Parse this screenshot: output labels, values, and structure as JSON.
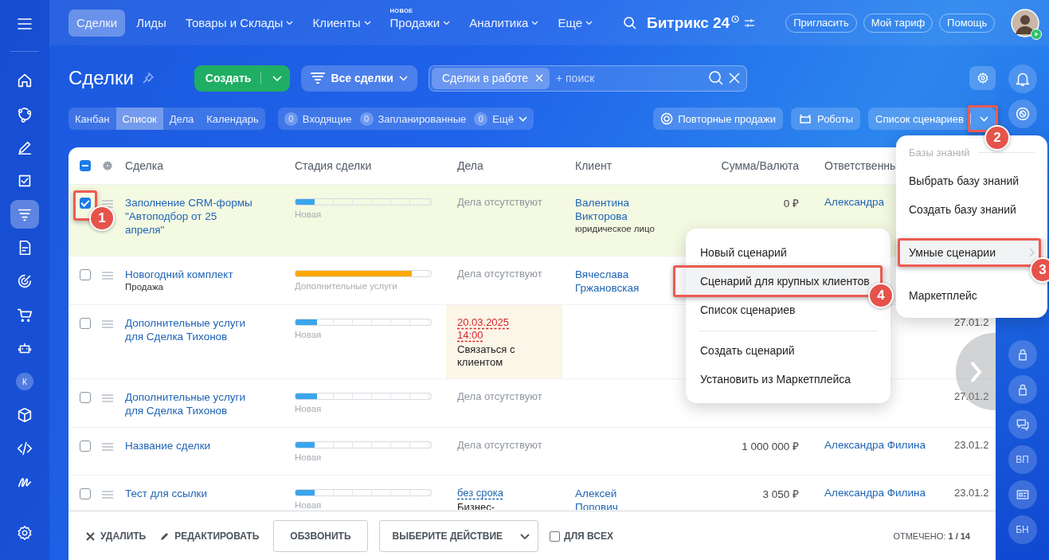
{
  "sidebar": {
    "items": [
      {
        "kind": "icon",
        "selected": false
      },
      {
        "kind": "icon",
        "selected": false
      },
      {
        "kind": "icon",
        "selected": false
      },
      {
        "kind": "icon",
        "selected": false
      },
      {
        "kind": "icon",
        "selected": true
      },
      {
        "kind": "icon",
        "selected": false
      },
      {
        "kind": "icon",
        "selected": false
      },
      {
        "kind": "icon",
        "selected": false
      },
      {
        "kind": "icon",
        "selected": false
      },
      {
        "kind": "avatar",
        "label": "К",
        "selected": false
      },
      {
        "kind": "icon",
        "selected": false
      },
      {
        "kind": "icon",
        "selected": false
      },
      {
        "kind": "icon",
        "selected": false
      }
    ]
  },
  "nav": {
    "tabs": [
      {
        "label": "Сделки",
        "selected": true,
        "dropdown": false
      },
      {
        "label": "Лиды",
        "selected": false,
        "dropdown": false
      },
      {
        "label": "Товары и Склады",
        "selected": false,
        "dropdown": true
      },
      {
        "label": "Клиенты",
        "selected": false,
        "dropdown": true
      },
      {
        "label": "Продажи",
        "selected": false,
        "dropdown": true,
        "badge": "НОВОЕ"
      },
      {
        "label": "Аналитика",
        "selected": false,
        "dropdown": true
      },
      {
        "label": "Еще",
        "selected": false,
        "dropdown": true
      }
    ],
    "logo": "Битрикс",
    "logo_number": "24",
    "buttons": [
      "Пригласить",
      "Мой тариф",
      "Помощь"
    ]
  },
  "page": {
    "title": "Сделки",
    "create_button": "Создать",
    "filter_button": "Все сделки",
    "search": {
      "chip": "Сделки в работе",
      "placeholder": "+ поиск"
    }
  },
  "views": [
    {
      "label": "Канбан",
      "selected": false
    },
    {
      "label": "Список",
      "selected": true
    },
    {
      "label": "Дела",
      "selected": false
    },
    {
      "label": "Календарь",
      "selected": false
    }
  ],
  "counters": [
    {
      "count": "0",
      "label": "Входящие",
      "dropdown": false
    },
    {
      "count": "0",
      "label": "Запланированные",
      "dropdown": false
    },
    {
      "count": "0",
      "label": "Ещё",
      "dropdown": true
    }
  ],
  "tools": {
    "repeat_sales": "Повторные продажи",
    "robots": "Роботы",
    "scenarios": {
      "label": "Список сценариев",
      "callout": "2"
    }
  },
  "table": {
    "header_checkbox": {
      "indeterminate": true
    },
    "columns": [
      "Сделка",
      "Стадия сделки",
      "Дела",
      "Клиент",
      "Сумма/Валюта",
      "Ответственны"
    ],
    "rows": [
      {
        "checked": true,
        "callout": "1",
        "title": "Заполнение CRM-формы \"Автоподбор от 25 апреля\"",
        "stage": {
          "label": "Новая",
          "level": 0.14,
          "color": "#3aa5ec"
        },
        "activity": {
          "kind": "none",
          "text": "Дела отсутствуют"
        },
        "client": {
          "name": "Валентина Викторова",
          "type": "юридическое лицо"
        },
        "sum": "0 ₽",
        "responsible": "Александра"
      },
      {
        "checked": false,
        "title": "Новогодний комплект",
        "subtitle": "Продажа",
        "stage": {
          "label": "Дополнительные услуги",
          "level": 0.86,
          "color": "#ffa800"
        },
        "activity": {
          "kind": "none",
          "text": "Дела отсутствуют"
        },
        "client": {
          "name": "Вячеслава Гржановская"
        }
      },
      {
        "checked": false,
        "title": "Дополнительные услуги для Сделка Тихонов",
        "stage": {
          "label": "Новая",
          "level": 0.16,
          "color": "#3aa5ec"
        },
        "activity": {
          "kind": "deadline",
          "date": "20.03.2025 14:00",
          "text": "Связаться с клиентом"
        },
        "date": "27.01.2"
      },
      {
        "checked": false,
        "title": "Дополнительные услуги для Сделка Тихонов",
        "stage": {
          "label": "Новая",
          "level": 0.16,
          "color": "#3aa5ec"
        },
        "activity": {
          "kind": "none",
          "text": "Дела отсутствуют"
        },
        "date": "27.01.2"
      },
      {
        "checked": false,
        "title": "Название сделки",
        "stage": {
          "label": "Новая",
          "level": 0.14,
          "color": "#3aa5ec"
        },
        "activity": {
          "kind": "none",
          "text": "Дела отсутствуют"
        },
        "sum": "1 000 000 ₽",
        "responsible": "Александра Филина",
        "date": "23.01.2"
      },
      {
        "checked": false,
        "title": "Тест для ссылки",
        "stage": {
          "label": "Новая",
          "level": 0.14,
          "color": "#3aa5ec"
        },
        "activity": {
          "kind": "no_deadline",
          "date": "без срока",
          "text": "Бизнес-"
        },
        "client": {
          "name": "Алексей Попович"
        },
        "sum": "3 050 ₽",
        "responsible": "Александра Филина",
        "date": "23.01.2"
      }
    ]
  },
  "menu": {
    "heading": "Базы знаний",
    "items": [
      {
        "label": "Выбрать базу знаний",
        "selected": false,
        "submenu": false
      },
      {
        "label": "Создать базу знаний",
        "selected": false,
        "submenu": false
      },
      {
        "label": "Умные сценарии",
        "selected": true,
        "submenu": true,
        "callout": "3"
      },
      {
        "label": "Маркетплейс",
        "selected": false,
        "submenu": false
      }
    ]
  },
  "submenu": {
    "items": [
      {
        "label": "Новый сценарий",
        "selected": false,
        "divider_before": false
      },
      {
        "label": "Сценарий для крупных клиентов",
        "selected": true,
        "divider_before": false,
        "callout": "4"
      },
      {
        "label": "Список сценариев",
        "selected": false,
        "divider_before": false
      },
      {
        "label": "Создать сценарий",
        "selected": false,
        "divider_before": true
      },
      {
        "label": "Установить из Маркетплейса",
        "selected": false,
        "divider_before": false
      }
    ]
  },
  "right_rail": {
    "top": [
      {
        "kind": "icon"
      },
      {
        "kind": "icon"
      }
    ],
    "bottom": [
      {
        "kind": "icon"
      },
      {
        "kind": "icon"
      },
      {
        "kind": "icon"
      },
      {
        "kind": "initials",
        "label": "ВП"
      },
      {
        "kind": "icon"
      },
      {
        "kind": "initials",
        "label": "БН"
      }
    ]
  },
  "bulk_bar": {
    "delete": "УДАЛИТЬ",
    "edit": "РЕДАКТИРОВАТЬ",
    "call": "ОБЗВОНИТЬ",
    "action": "ВЫБЕРИТЕ ДЕЙСТВИЕ",
    "for_all": {
      "label": "ДЛЯ ВСЕХ",
      "checked": false
    },
    "selected_count": "ОТМЕЧЕНО: **1 / 14**"
  }
}
